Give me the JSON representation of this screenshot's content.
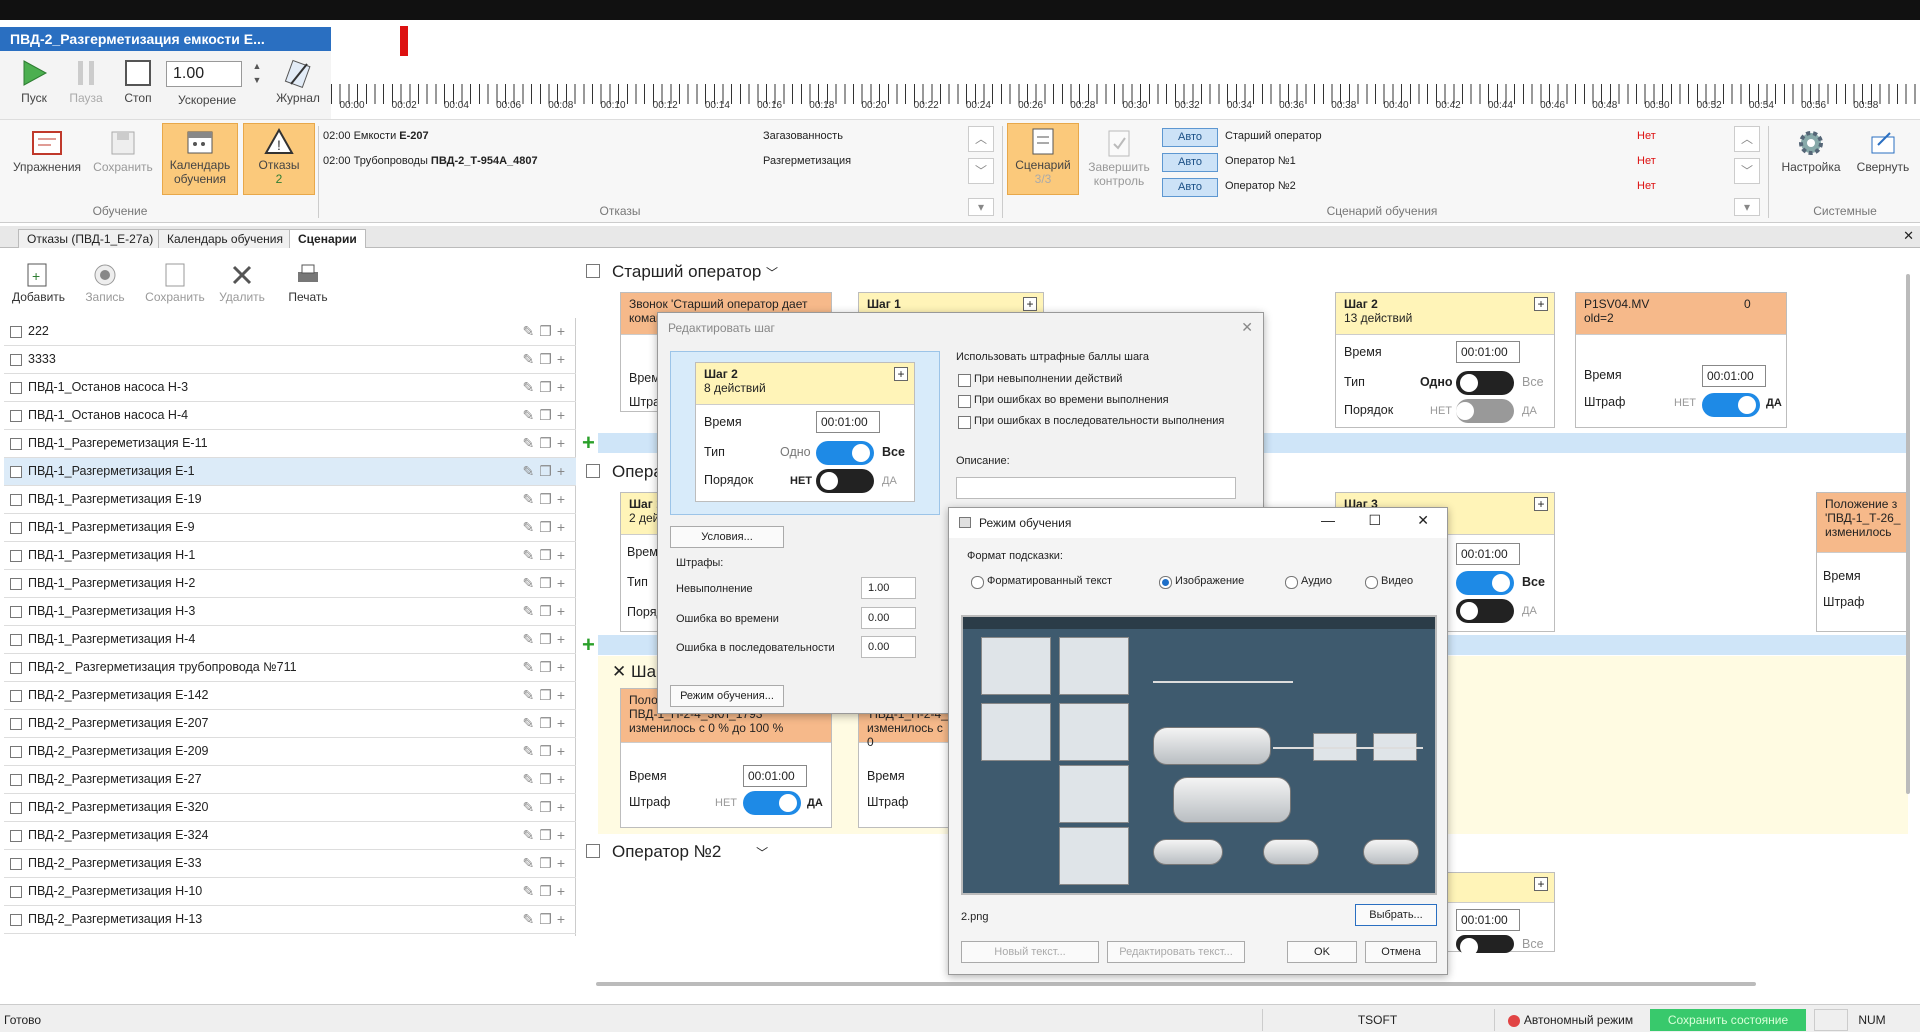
{
  "window": {
    "title": "ПВД-2_Разгерметизация емкости Е..."
  },
  "transport": {
    "play": "Пуск",
    "pause": "Пауза",
    "stop": "Стоп",
    "speed_value": "1.00",
    "speed_label": "Ускорение",
    "journal": "Журнал"
  },
  "timeline": {
    "ticks": [
      "00:00",
      "00:02",
      "00:04",
      "00:06",
      "00:08",
      "00:10",
      "00:12",
      "00:14",
      "00:16",
      "00:18",
      "00:20",
      "00:22",
      "00:24",
      "00:26",
      "00:28",
      "00:30",
      "00:32",
      "00:34",
      "00:36",
      "00:38",
      "00:40",
      "00:42",
      "00:44",
      "00:46",
      "00:48",
      "00:50",
      "00:52",
      "00:54",
      "00:56",
      "00:58"
    ]
  },
  "ribbon": {
    "exercises": "Упражнения",
    "save": "Сохранить",
    "calendar_l1": "Календарь",
    "calendar_l2": "обучения",
    "faults": "Отказы",
    "faults_count": "2",
    "group_training": "Обучение",
    "group_faults": "Отказы",
    "fault_rows": [
      {
        "time": "02:00",
        "obj": "Емкости",
        "id": "Е-207",
        "type": "Загазованность"
      },
      {
        "time": "02:00",
        "obj": "Трубопроводы",
        "id": "ПВД-2_Т-954А_4807",
        "type": "Разгерметизация"
      }
    ],
    "scenario": "Сценарий",
    "scenario_count": "3/3",
    "finish_l1": "Завершить",
    "finish_l2": "контроль",
    "operators": [
      {
        "mode": "Авто",
        "name": "Старший оператор",
        "status": "Нет"
      },
      {
        "mode": "Авто",
        "name": "Оператор №1",
        "status": "Нет"
      },
      {
        "mode": "Авто",
        "name": "Оператор №2",
        "status": "Нет"
      }
    ],
    "group_scenario": "Сценарий обучения",
    "settings": "Настройка",
    "minimize": "Свернуть",
    "group_system": "Системные"
  },
  "tabs": [
    "Отказы (ПВД-1_Е-27а)",
    "Календарь обучения",
    "Сценарии"
  ],
  "left_toolbar": {
    "add": "Добавить",
    "record": "Запись",
    "save": "Сохранить",
    "delete": "Удалить",
    "print": "Печать"
  },
  "scenario_list": [
    "222",
    "3333",
    "ПВД-1_Останов насоса Н-3",
    "ПВД-1_Останов насоса Н-4",
    "ПВД-1_Разгереметизация Е-11",
    "ПВД-1_Разгерметизация Е-1",
    "ПВД-1_Разгерметизация Е-19",
    "ПВД-1_Разгерметизация Е-9",
    "ПВД-1_Разгерметизация Н-1",
    "ПВД-1_Разгерметизация Н-2",
    "ПВД-1_Разгерметизация Н-3",
    "ПВД-1_Разгерметизация Н-4",
    "ПВД-2_ Разгерметизация трубопровода №711",
    "ПВД-2_Разгерметизация Е-142",
    "ПВД-2_Разгерметизация Е-207",
    "ПВД-2_Разгерметизация Е-209",
    "ПВД-2_Разгерметизация Е-27",
    "ПВД-2_Разгерметизация Е-320",
    "ПВД-2_Разгерметизация Е-324",
    "ПВД-2_Разгерметизация Е-33",
    "ПВД-2_Разгерметизация Н-10",
    "ПВД-2_Разгерметизация Н-13"
  ],
  "selected_index": 5,
  "main": {
    "senior_operator": "Старший оператор",
    "operator_partial": "Опера",
    "step_partial": "Ша",
    "operator2": "Оператор №2",
    "card_call": "Звонок 'Старший оператор дает коман",
    "step1": "Шаг 1",
    "step1_sub": "2 дей",
    "step2_title": "Шаг 2",
    "step2_sub": "13 действий",
    "p1sv_title": "P1SV04.MV",
    "p1sv_value": "0",
    "p1sv_old": "old=2",
    "step3": "Шаг 3",
    "position_l1": "Положение з",
    "position_l2": "'ПВД-1_Т-26_",
    "position_l3": "изменилось",
    "pos_card_l1": "Полож",
    "pos_card_l2": "ПВД-1_Н-2-4_3КЛ_1793",
    "pos_card_l3": "изменилось с 0 % до 100 %",
    "pos_card2_l2": "'ПВД-1_Н-2-4_",
    "pos_card2_l3": "изменилось с 0",
    "time_label": "Время",
    "type_label": "Тип",
    "order_label": "Порядок",
    "penalty_label": "Штраф",
    "time_value": "00:01:00",
    "one": "Одно",
    "all": "Все",
    "no": "НЕТ",
    "yes": "ДА",
    "time_short": "Врем",
    "penalty_short": "Штраф",
    "type_short": "Тип",
    "order_short": "Поряд"
  },
  "edit_step_dialog": {
    "title": "Редактировать шаг",
    "step_title": "Шаг 2",
    "step_sub": "8 действий",
    "time_label": "Время",
    "time_value": "00:01:00",
    "type_label": "Тип",
    "one": "Одно",
    "all": "Все",
    "order_label": "Порядок",
    "no": "НЕТ",
    "yes": "ДА",
    "conditions_btn": "Условия...",
    "penalties": "Штрафы:",
    "penalty_rows": [
      {
        "label": "Невыполнение",
        "value": "1.00"
      },
      {
        "label": "Ошибка во времени",
        "value": "0.00"
      },
      {
        "label": "Ошибка в последовательности",
        "value": "0.00"
      }
    ],
    "training_mode_btn": "Режим обучения...",
    "use_penalty": "Использовать штрафные баллы шага",
    "checks": [
      "При невыполнении действий",
      "При ошибках во времени выполнения",
      "При ошибках в последовательности выполнения"
    ],
    "description": "Описание:"
  },
  "training_dialog": {
    "title": "Режим обучения",
    "hint_format": "Формат подсказки:",
    "options": [
      "Форматированный текст",
      "Изображение",
      "Аудио",
      "Видео"
    ],
    "selected_option": 1,
    "filename": "2.png",
    "choose_btn": "Выбрать...",
    "new_text": "Новый текст...",
    "edit_text": "Редактировать текст...",
    "ok": "OK",
    "cancel": "Отмена"
  },
  "status": {
    "ready": "Готово",
    "tsoft": "TSOFT",
    "autonomous": "Автономный режим",
    "save_state": "Сохранить состояние",
    "num": "NUM"
  }
}
